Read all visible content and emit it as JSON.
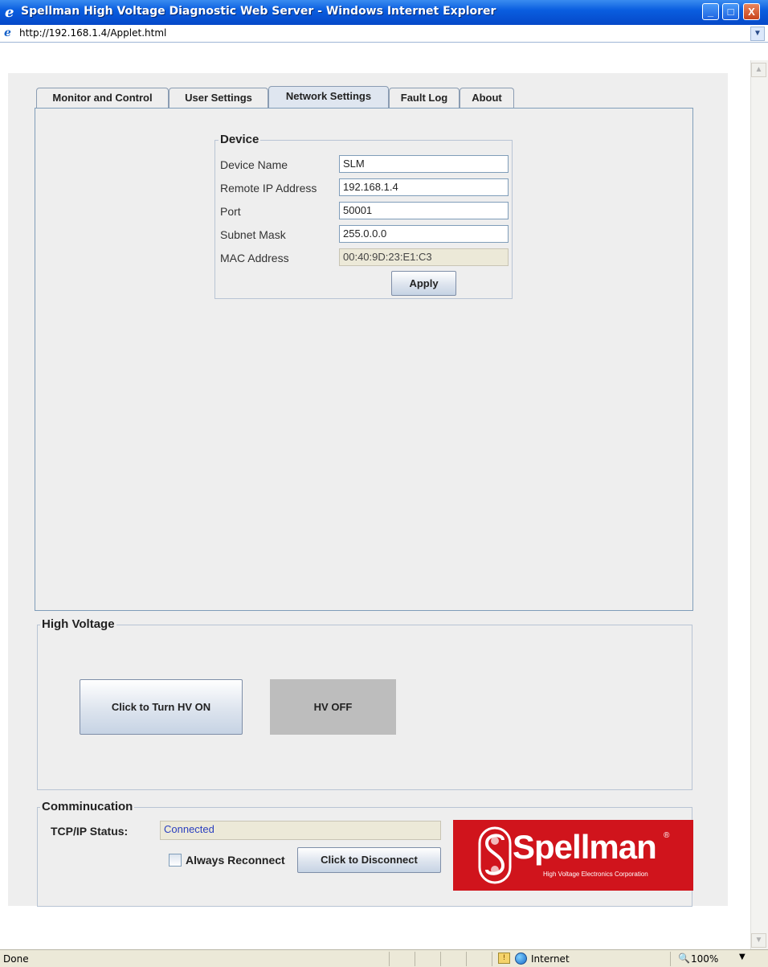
{
  "window": {
    "title": "Spellman High Voltage Diagnostic Web Server - Windows Internet Explorer",
    "minimize": "_",
    "maximize": "□",
    "close": "X"
  },
  "address": {
    "url": "http://192.168.1.4/Applet.html"
  },
  "tabs": [
    {
      "label": "Monitor and Control",
      "selected": false
    },
    {
      "label": "User Settings",
      "selected": false
    },
    {
      "label": "Network Settings",
      "selected": true
    },
    {
      "label": "Fault Log",
      "selected": false
    },
    {
      "label": "About",
      "selected": false
    }
  ],
  "device": {
    "legend": "Device",
    "fields": [
      {
        "label": "Device Name",
        "value": "SLM"
      },
      {
        "label": "Remote IP Address",
        "value": "192.168.1.4"
      },
      {
        "label": "Port",
        "value": "50001"
      },
      {
        "label": "Subnet Mask",
        "value": "255.0.0.0"
      },
      {
        "label": "MAC Address",
        "value": "00:40:9D:23:E1:C3"
      }
    ],
    "apply_label": "Apply"
  },
  "high_voltage": {
    "legend": "High Voltage",
    "turn_on_label": "Click to Turn HV ON",
    "status_label": "HV OFF"
  },
  "communication": {
    "legend": "Comminucation",
    "status_label": "TCP/IP Status:",
    "status_value": "Connected",
    "reconnect_label": "Always Reconnect",
    "reconnect_checked": false,
    "disconnect_label": "Click to Disconnect"
  },
  "logo": {
    "brand": "Spellman",
    "tagline": "High Voltage Electronics Corporation",
    "registered": "®",
    "color": "#d0141c"
  },
  "statusbar": {
    "status": "Done",
    "zone": "Internet",
    "zoom": "100%"
  },
  "colors": {
    "titlebar": "#0a5ee0",
    "panel_bg": "#eeeeee",
    "hv_off_bg": "#bdbdbd",
    "connected_text": "#2a3fbf"
  }
}
